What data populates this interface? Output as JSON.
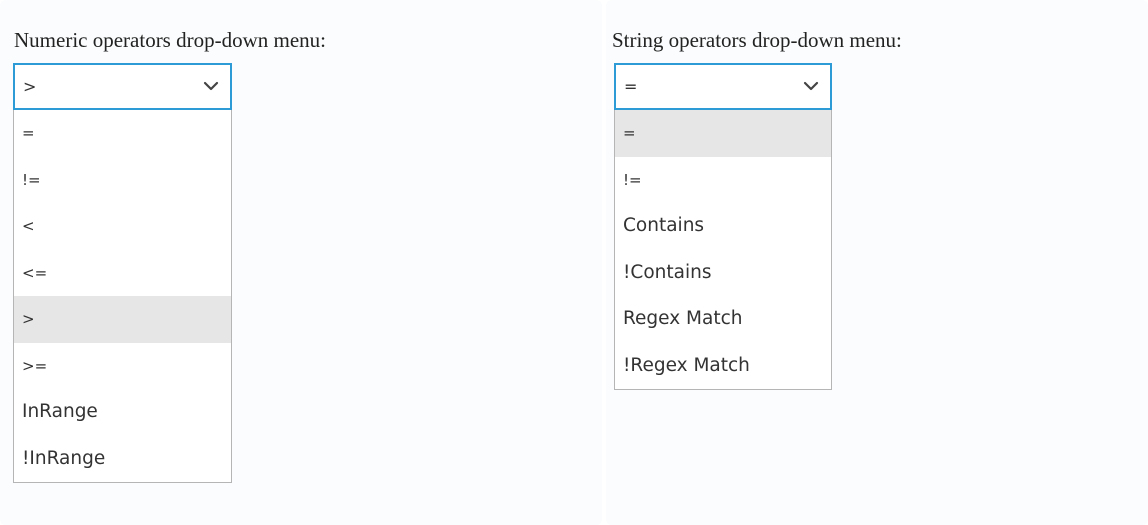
{
  "numeric": {
    "caption": "Numeric operators drop-down menu:",
    "selected": ">",
    "options": [
      "=",
      "!=",
      "<",
      "<=",
      ">",
      ">=",
      "InRange",
      "!InRange"
    ],
    "highlighted_index": 4
  },
  "string": {
    "caption": "String operators drop-down menu:",
    "selected": "=",
    "options": [
      "=",
      "!=",
      "Contains",
      "!Contains",
      "Regex Match",
      "!Regex Match"
    ],
    "highlighted_index": 0
  },
  "colors": {
    "focus_border": "#2d9bd6",
    "highlight": "#e6e6e6",
    "menu_border": "#b5b5b5"
  },
  "icons": {
    "select_arrow": "chevron-down-icon"
  }
}
